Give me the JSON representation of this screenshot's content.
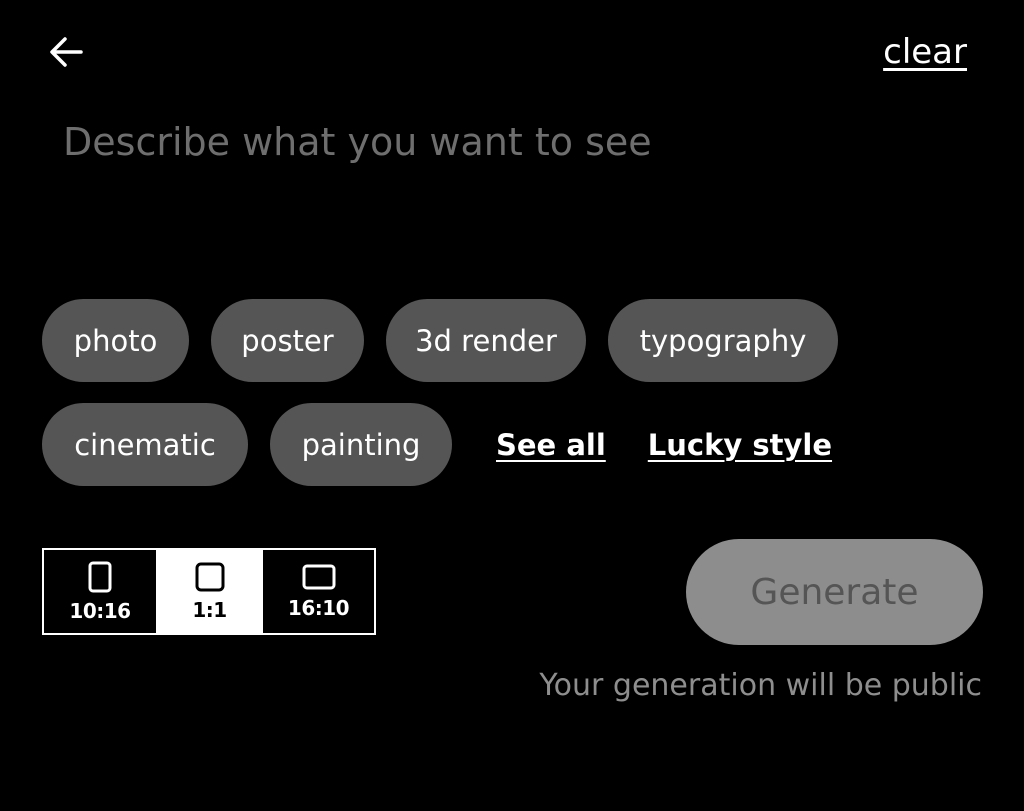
{
  "header": {
    "back_icon": "arrow-left-icon",
    "clear_label": "clear"
  },
  "prompt": {
    "value": "",
    "placeholder": "Describe what you want to see"
  },
  "styles": {
    "row1": [
      "photo",
      "poster",
      "3d render",
      "typography"
    ],
    "row2": [
      "cinematic",
      "painting"
    ],
    "see_all_label": "See all",
    "lucky_label": "Lucky style"
  },
  "aspect_ratios": {
    "options": [
      {
        "label": "10:16",
        "icon": "portrait-frame-icon"
      },
      {
        "label": "1:1",
        "icon": "square-frame-icon"
      },
      {
        "label": "16:10",
        "icon": "landscape-frame-icon"
      }
    ],
    "selected": "1:1"
  },
  "generate": {
    "label": "Generate"
  },
  "footer": {
    "public_note": "Your generation will be public"
  },
  "colors": {
    "background": "#000000",
    "chip": "#555555",
    "generate_disabled": "#8d8d8d",
    "placeholder": "#6e6e6e"
  }
}
